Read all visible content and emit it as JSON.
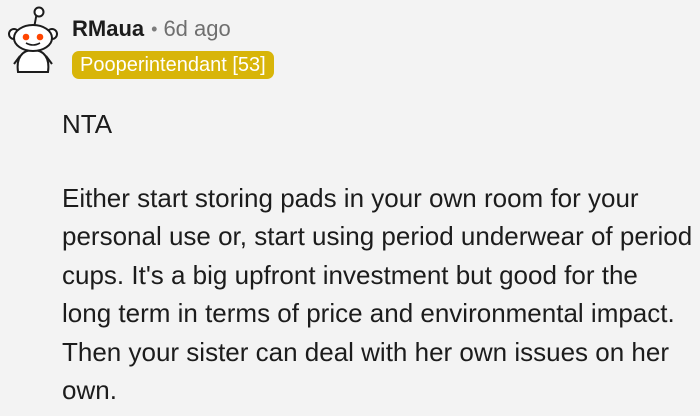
{
  "comment": {
    "author": "RMaua",
    "separator": "•",
    "timestamp": "6d ago",
    "flair": "Pooperintendant [53]",
    "avatar_icon": "snoo-avatar-icon",
    "paragraphs": [
      "NTA",
      "Either start storing pads in your own room for your personal use or, start using period underwear of period cups. It's a big upfront investment but good for the long term in terms of price and environmental impact. Then your sister can deal with her own issues on her own."
    ]
  },
  "colors": {
    "background": "#f3f3f3",
    "flair_background": "#d8b509",
    "avatar_eye_red": "#ff4500"
  }
}
